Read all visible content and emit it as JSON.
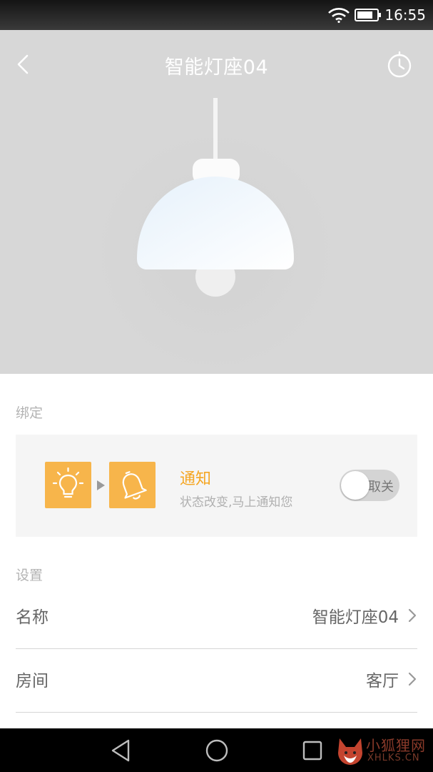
{
  "statusbar": {
    "time": "16:55",
    "icons": [
      "wifi-icon",
      "battery-icon"
    ]
  },
  "header": {
    "title": "智能灯座04",
    "back_icon": "chevron-left-icon",
    "timer_icon": "clock-icon"
  },
  "binding": {
    "section_label": "绑定",
    "title": "通知",
    "subtitle": "状态改变,马上通知您",
    "toggle_label": "取关",
    "toggle_on": false,
    "trigger_icon": "lightbulb-icon",
    "action_icon": "bell-icon"
  },
  "settings": {
    "section_label": "设置",
    "rows": [
      {
        "label": "名称",
        "value": "智能灯座04"
      },
      {
        "label": "房间",
        "value": "客厅"
      }
    ]
  },
  "navbar": {
    "buttons": [
      "back-triangle-icon",
      "home-circle-icon",
      "recents-square-icon"
    ]
  },
  "watermark": {
    "text_cn": "小狐狸网",
    "text_en": "XHLKS.CN"
  },
  "colors": {
    "accent": "#f7b54b",
    "accent_text": "#f5a623",
    "hero_bg": "#d7d7d7"
  }
}
